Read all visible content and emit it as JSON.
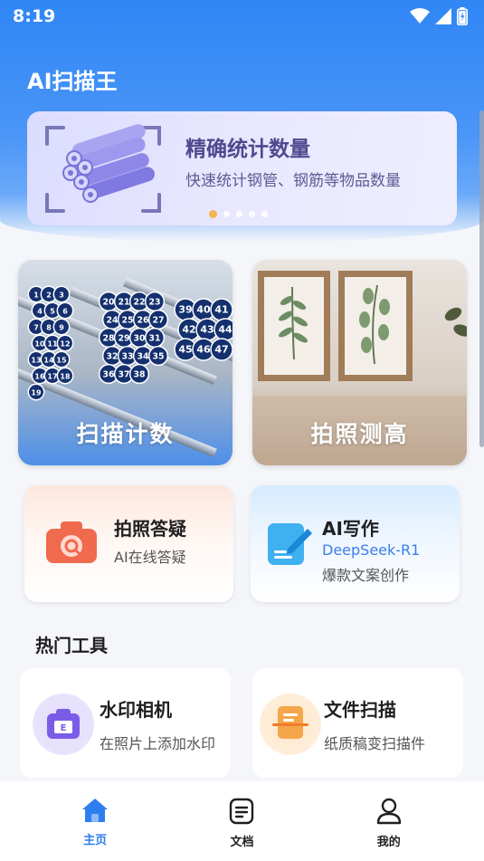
{
  "status": {
    "time": "8:19"
  },
  "app": {
    "title": "AI扫描王"
  },
  "banner": {
    "title": "精确统计数量",
    "subtitle": "快速统计钢管、钢筋等物品数量",
    "slides": 5,
    "active_slide": 0
  },
  "features": {
    "scan_count": {
      "label": "扫描计数"
    },
    "measure_height": {
      "label": "拍照测高"
    },
    "photo_qa": {
      "title": "拍照答疑",
      "subtitle": "AI在线答疑"
    },
    "ai_write": {
      "title": "AI写作",
      "accent": "DeepSeek-R1",
      "subtitle": "爆款文案创作"
    }
  },
  "hot_tools": {
    "title": "热门工具",
    "items": [
      {
        "title": "水印相机",
        "subtitle": "在照片上添加水印",
        "icon": "watermark-camera-icon"
      },
      {
        "title": "文件扫描",
        "subtitle": "纸质稿变扫描件",
        "icon": "document-scan-icon"
      }
    ]
  },
  "tabs": [
    {
      "label": "主页",
      "icon": "home-icon",
      "active": true
    },
    {
      "label": "文档",
      "icon": "document-icon",
      "active": false
    },
    {
      "label": "我的",
      "icon": "profile-icon",
      "active": false
    }
  ],
  "pipe_numbers": [
    "1",
    "2",
    "3",
    "4",
    "5",
    "6",
    "7",
    "8",
    "9",
    "10",
    "11",
    "12",
    "13",
    "14",
    "15",
    "16",
    "17",
    "18",
    "19",
    "20",
    "21",
    "22",
    "23",
    "24",
    "25",
    "26",
    "27",
    "28",
    "29",
    "30",
    "31",
    "32",
    "33",
    "34",
    "35",
    "36",
    "37",
    "38",
    "39",
    "40",
    "41",
    "42",
    "43",
    "44",
    "45",
    "46",
    "47"
  ],
  "colors": {
    "primary": "#2f7ef0",
    "banner_text": "#4f4a8f",
    "accent_orange": "#f6b54a"
  }
}
